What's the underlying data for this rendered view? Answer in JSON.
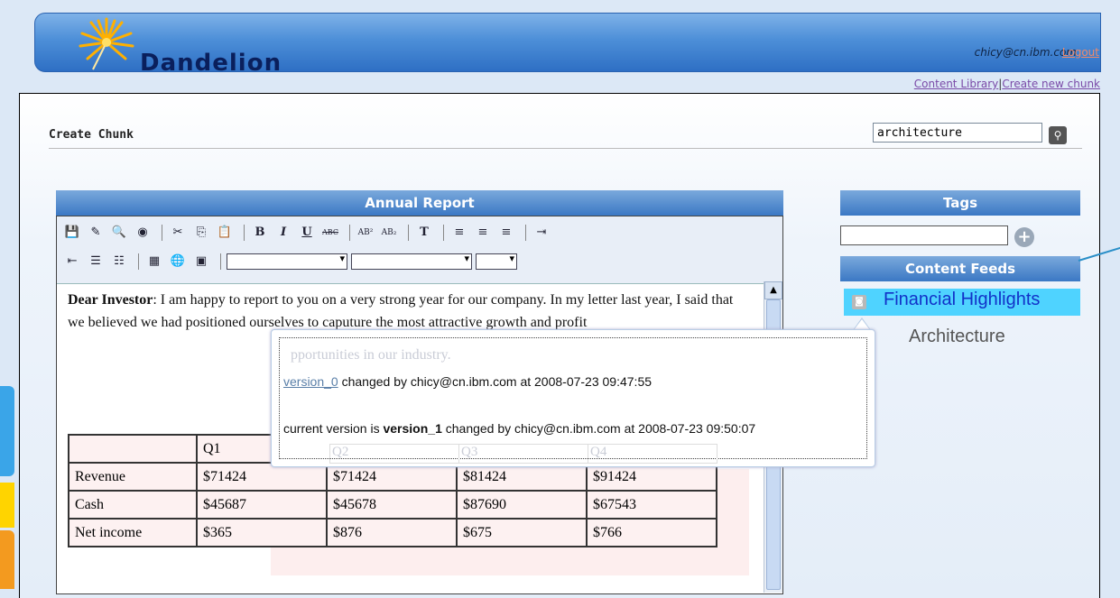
{
  "header": {
    "logo_text": "Dandelion",
    "user": "chicy@cn.ibm.com",
    "logout": "Logout"
  },
  "links": {
    "content_library": "Content Library",
    "separator": "|",
    "create_new_chunk": "Create new chunk"
  },
  "page": {
    "title": "Create Chunk",
    "search_value": "architecture"
  },
  "editor": {
    "title": "Annual Report",
    "intro_bold": "Dear Investor",
    "intro_rest": ": I am happy to report to you on a very strong year for our company. In my letter last year, I said that we believed we had positioned ourselves to caputure the most attractive growth and profit",
    "table": {
      "header": [
        "",
        "Q1",
        "Q2",
        "Q3",
        "Q4"
      ],
      "rows": [
        [
          "Revenue",
          "$71424",
          "$71424",
          "$81424",
          "$91424"
        ],
        [
          "Cash",
          "$45687",
          "$45678",
          "$87690",
          "$67543"
        ],
        [
          "Net income",
          "$365",
          "$876",
          "$675",
          "$766"
        ]
      ]
    }
  },
  "tooltip": {
    "ghost_text": "pportunities in our industry.",
    "version0_link": "version_0",
    "version0_text": " changed by chicy@cn.ibm.com at 2008-07-23 09:47:55",
    "current_prefix": "current version is ",
    "current_version": "version_1",
    "current_text": " changed by chicy@cn.ibm.com at 2008-07-23 09:50:07"
  },
  "sidebar": {
    "tags_title": "Tags",
    "feeds_title": "Content Feeds",
    "feeds": [
      "Financial Highlights",
      "Architecture"
    ]
  },
  "colors": {
    "header_blue": "#2e6fc4",
    "feed_highlight": "#4fd3ff",
    "feed_link": "#1232c8"
  }
}
